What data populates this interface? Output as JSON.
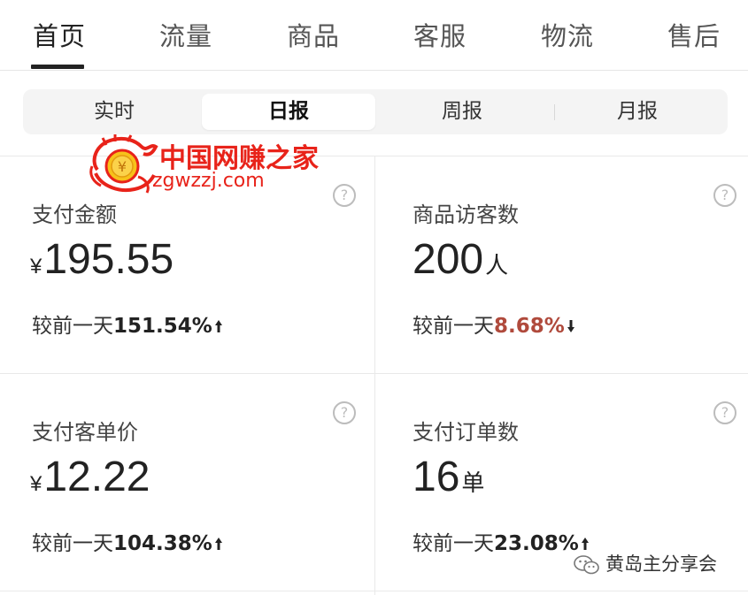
{
  "nav": {
    "tabs": [
      {
        "label": "首页",
        "active": true
      },
      {
        "label": "流量",
        "active": false
      },
      {
        "label": "商品",
        "active": false
      },
      {
        "label": "客服",
        "active": false
      },
      {
        "label": "物流",
        "active": false
      },
      {
        "label": "售后",
        "active": false
      }
    ]
  },
  "segment": {
    "items": [
      {
        "label": "实时",
        "active": false
      },
      {
        "label": "日报",
        "active": true
      },
      {
        "label": "周报",
        "active": false
      },
      {
        "label": "月报",
        "active": false
      }
    ]
  },
  "logo": {
    "cn": "中国网赚之家",
    "en": "zgwzzj.com"
  },
  "cards": [
    {
      "label": "支付金额",
      "prefix": "¥",
      "value": "195.55",
      "unit": "",
      "compare_label": "较前一天",
      "compare_pct": "151.54%",
      "trend": "up"
    },
    {
      "label": "商品访客数",
      "prefix": "",
      "value": "200",
      "unit": "人",
      "compare_label": "较前一天",
      "compare_pct": "8.68%",
      "trend": "down"
    },
    {
      "label": "支付客单价",
      "prefix": "¥",
      "value": "12.22",
      "unit": "",
      "compare_label": "较前一天",
      "compare_pct": "104.38%",
      "trend": "up"
    },
    {
      "label": "支付订单数",
      "prefix": "",
      "value": "16",
      "unit": "单",
      "compare_label": "较前一天",
      "compare_pct": "23.08%",
      "trend": "up"
    }
  ],
  "help_glyph": "?",
  "watermark": {
    "text": "黄岛主分享会",
    "icon": "wechat-icon"
  },
  "colors": {
    "accent_down": "#b04a3c",
    "logo_red": "#e8231a"
  }
}
